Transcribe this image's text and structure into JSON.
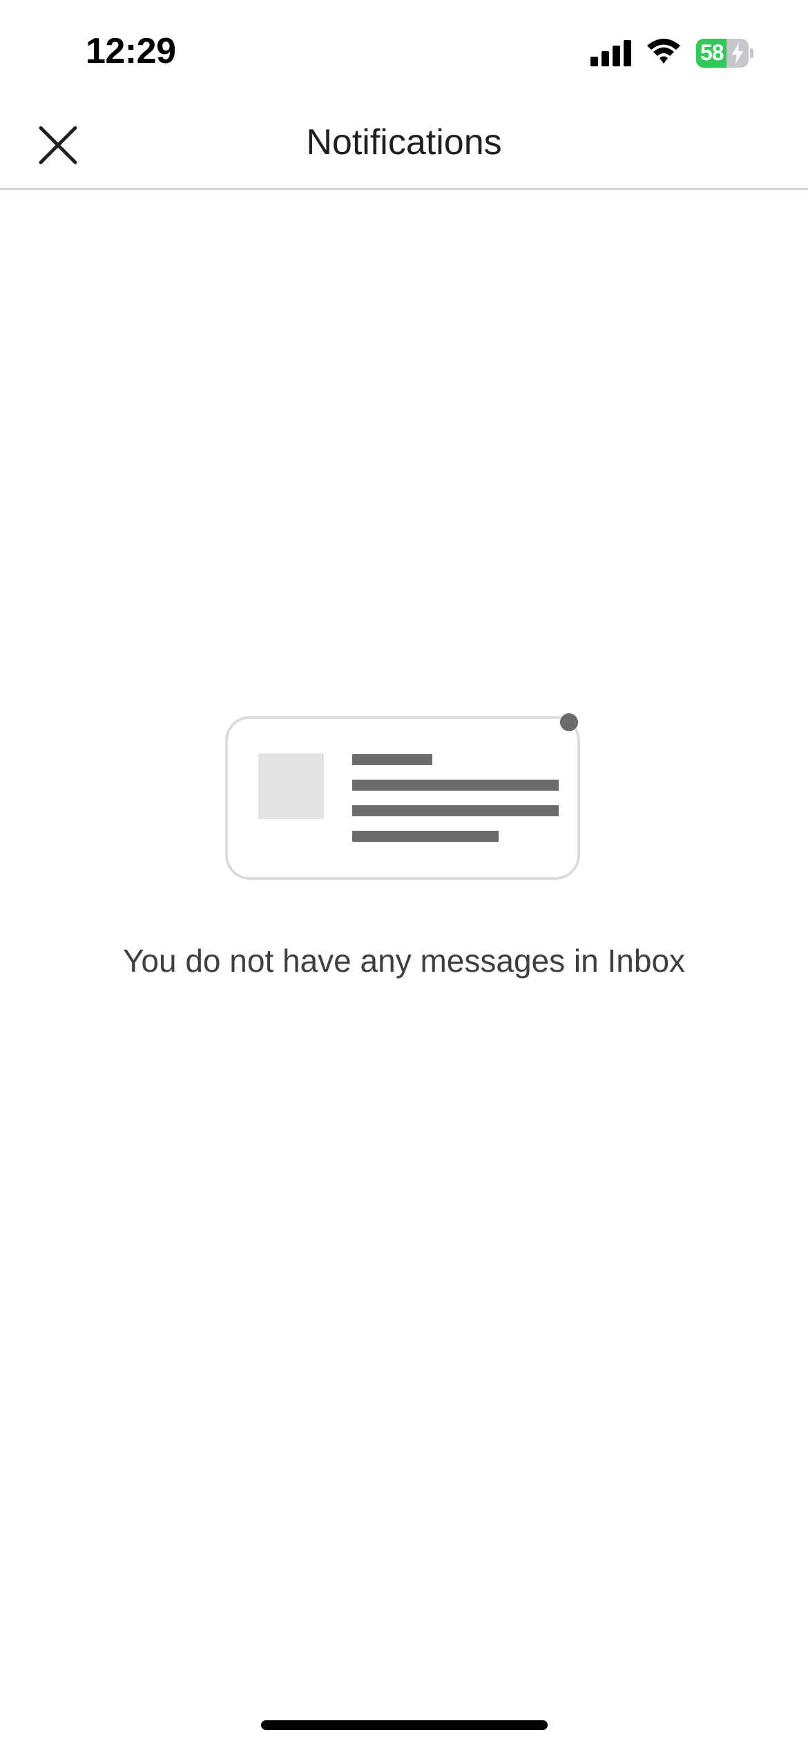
{
  "status_bar": {
    "time": "12:29",
    "battery_level": "58",
    "battery_fraction": 0.58,
    "signal_bars": 4,
    "charging": true,
    "icons": [
      "cellular-signal-icon",
      "wifi-icon",
      "battery-charging-icon"
    ]
  },
  "header": {
    "title": "Notifications",
    "close_icon": "close-icon"
  },
  "empty_state": {
    "message": "You do not have any messages in Inbox",
    "illustration_icon": "empty-inbox-illustration-icon"
  },
  "colors": {
    "background": "#ffffff",
    "text_primary": "#1f1f1f",
    "text_secondary": "#3f3f3f",
    "divider": "#d6d6d6",
    "illustration_lines": "#6b6b6b",
    "illustration_placeholder": "#e3e3e3",
    "battery_green": "#34c759"
  }
}
